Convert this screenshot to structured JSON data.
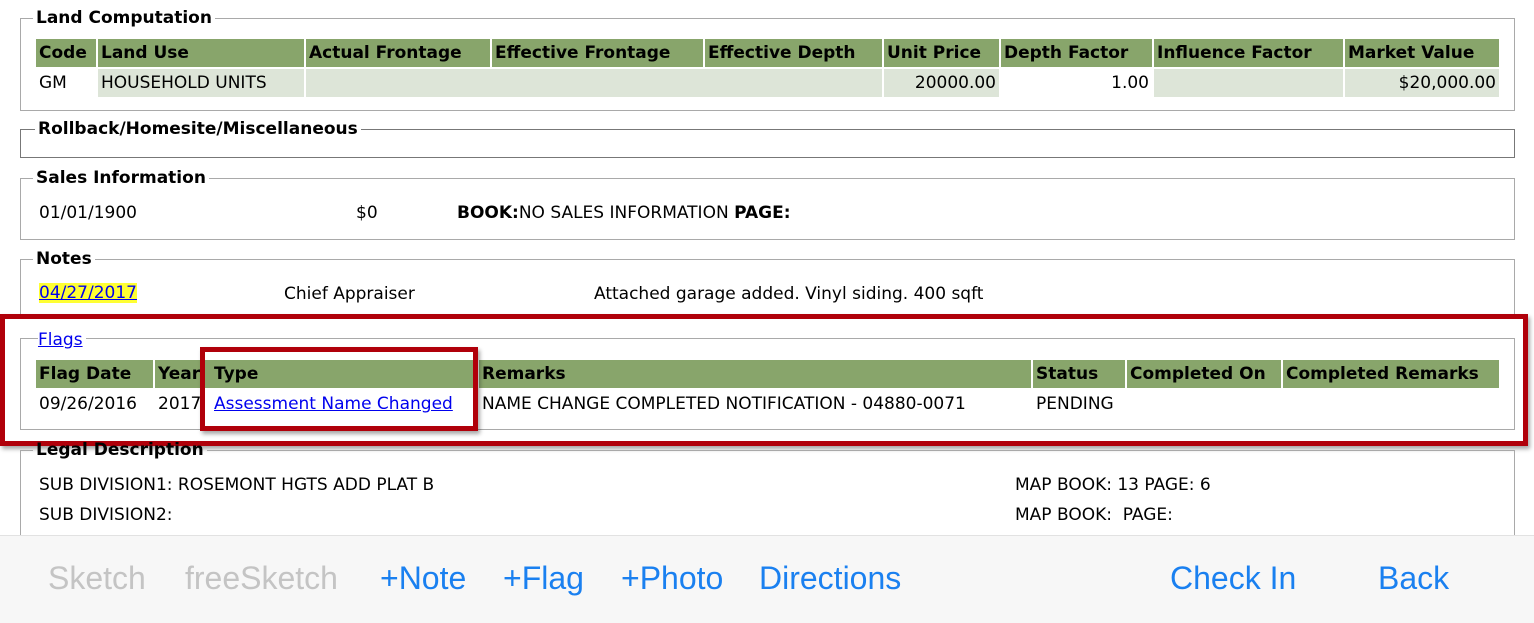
{
  "land": {
    "legend": "Land Computation",
    "headers": [
      "Code",
      "Land Use",
      "Actual Frontage",
      "Effective Frontage",
      "Effective Depth",
      "Unit Price",
      "Depth Factor",
      "Influence Factor",
      "Market Value"
    ],
    "row": {
      "code": "GM",
      "land_use": "HOUSEHOLD UNITS",
      "unit_price": "20000.00",
      "depth_factor": "1.00",
      "market_value": "$20,000.00"
    }
  },
  "rollback": {
    "legend": "Rollback/Homesite/Miscellaneous"
  },
  "sales": {
    "legend": "Sales Information",
    "date": "01/01/1900",
    "price": "$0",
    "book_label": "BOOK:",
    "book_value": "NO SALES INFORMATION",
    "page_label": "PAGE:"
  },
  "notes": {
    "legend": "Notes",
    "date": "04/27/2017",
    "author": "Chief Appraiser",
    "text": "Attached garage added. Vinyl siding. 400 sqft"
  },
  "flags": {
    "link": "Flags",
    "headers": [
      "Flag Date",
      "Year",
      "Type",
      "Remarks",
      "Status",
      "Completed On",
      "Completed Remarks"
    ],
    "row": {
      "flag_date": "09/26/2016",
      "year": "2017",
      "type": "Assessment Name Changed",
      "remarks": "NAME CHANGE COMPLETED NOTIFICATION - 04880-0071",
      "status": "PENDING"
    }
  },
  "legal": {
    "legend": "Legal Description",
    "sub1": "SUB DIVISION1: ROSEMONT HGTS ADD PLAT B",
    "sub2": "SUB DIVISION2:",
    "map1": "MAP BOOK: 13 PAGE: 6",
    "map2": "MAP BOOK:  PAGE:"
  },
  "toolbar": {
    "sketch": "Sketch",
    "freesketch": "freeSketch",
    "note": "+Note",
    "flag": "+Flag",
    "photo": "+Photo",
    "directions": "Directions",
    "checkin": "Check In",
    "back": "Back"
  },
  "colors": {
    "header_bg": "#88a56b",
    "row_bg": "#dde5d8",
    "highlight": "#b0000a",
    "toolbar_active": "#1a80f0",
    "toolbar_disabled": "#c4c4c4"
  }
}
